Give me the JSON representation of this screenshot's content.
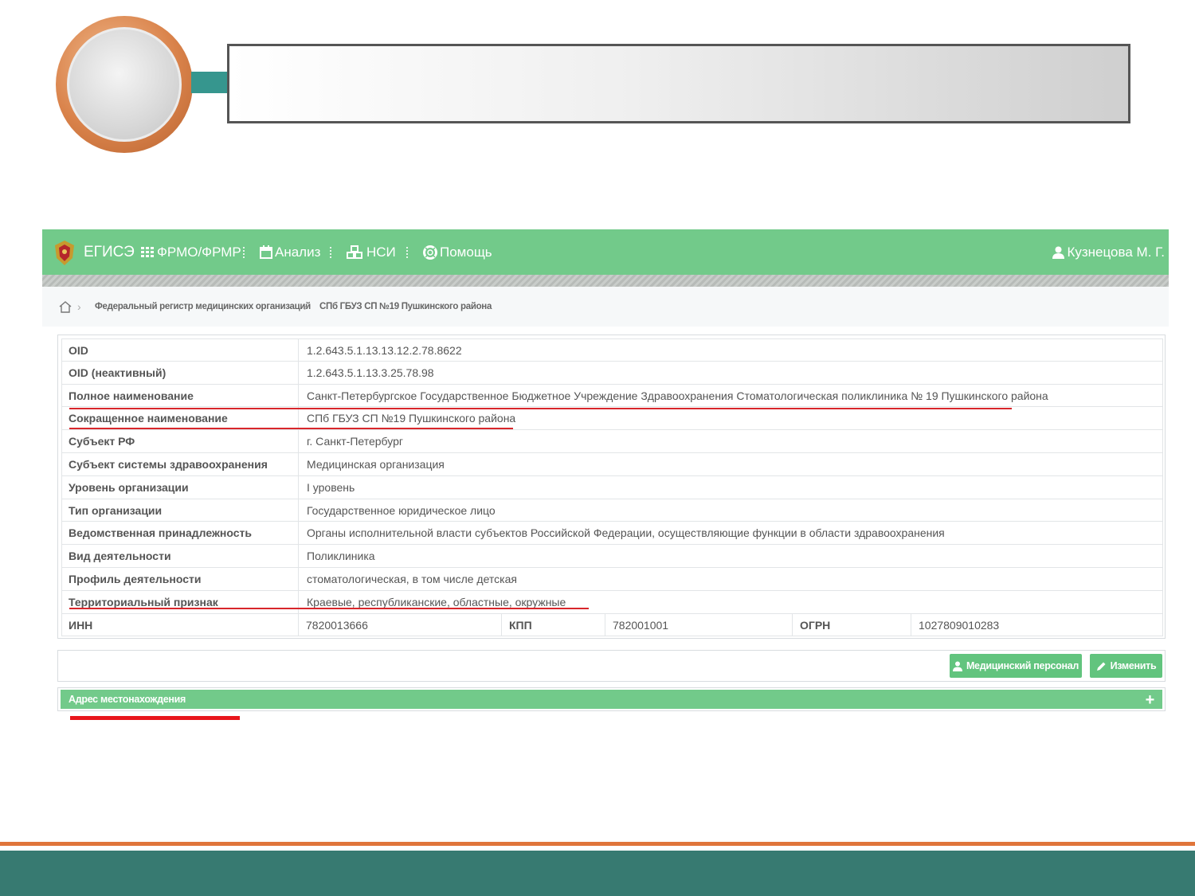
{
  "header": {
    "brand": "ЕГИСЭ",
    "nav": [
      {
        "label": "ФРМО/ФРМР",
        "icon": "grid-icon"
      },
      {
        "label": "Анализ",
        "icon": "calendar-icon"
      },
      {
        "label": "НСИ",
        "icon": "cubes-icon"
      },
      {
        "label": "Помощь",
        "icon": "lifebuoy-icon"
      }
    ],
    "user": "Кузнецова М. Г."
  },
  "breadcrumbs": {
    "home_icon": "home-icon",
    "items": [
      "Федеральный регистр медицинских организаций",
      "СПб ГБУЗ СП №19 Пушкинского района"
    ]
  },
  "details": {
    "rows": [
      {
        "key": "OID",
        "value": "1.2.643.5.1.13.13.12.2.78.8622"
      },
      {
        "key": "OID (неактивный)",
        "value": "1.2.643.5.1.13.3.25.78.98"
      },
      {
        "key": "Полное наименование",
        "value": "Санкт-Петербургское Государственное Бюджетное Учреждение Здравоохранения Стоматологическая поликлиника № 19 Пушкинского района"
      },
      {
        "key": "Сокращенное наименование",
        "value": "СПб ГБУЗ СП №19 Пушкинского района"
      },
      {
        "key": "Субъект РФ",
        "value": "г. Санкт-Петербург"
      },
      {
        "key": "Субъект системы здравоохранения",
        "value": "Медицинская организация"
      },
      {
        "key": "Уровень организации",
        "value": "I уровень"
      },
      {
        "key": "Тип организации",
        "value": "Государственное юридическое лицо"
      },
      {
        "key": "Ведомственная принадлежность",
        "value": "Органы исполнительной власти субъектов Российской Федерации, осуществляющие функции в области здравоохранения"
      },
      {
        "key": "Вид деятельности",
        "value": "Поликлиника"
      },
      {
        "key": "Профиль деятельности",
        "value": "стоматологическая, в том числе детская"
      },
      {
        "key": "Территориальный признак",
        "value": "Краевые, республиканские, областные, окружные"
      }
    ],
    "codes": {
      "inn_label": "ИНН",
      "inn": "7820013666",
      "kpp_label": "КПП",
      "kpp": "782001001",
      "ogrn_label": "ОГРН",
      "ogrn": "1027809010283"
    }
  },
  "actions": {
    "staff_label": "Медицинский персонал",
    "edit_label": "Изменить"
  },
  "address_panel": {
    "title": "Адрес местонахождения",
    "expand": "+"
  },
  "colors": {
    "navbar": "#72ca8a",
    "accent_orange": "#e0753a",
    "footer_teal": "#377a71",
    "highlight_red": "#d8262b"
  }
}
